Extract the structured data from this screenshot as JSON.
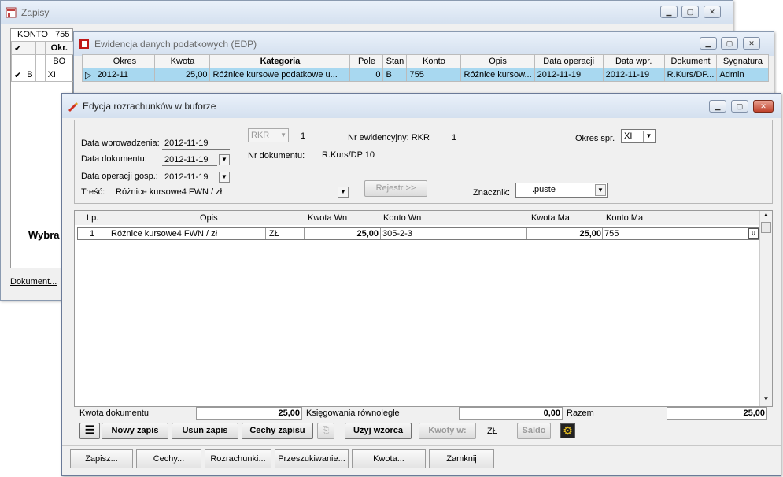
{
  "zapisy": {
    "title": "Zapisy",
    "konto_label": "KONTO",
    "konto_value": "755",
    "ok_header": "Okr.",
    "rows": [
      {
        "col1": "",
        "col2": "",
        "col3": "",
        "okr": "BO"
      },
      {
        "col1": "✔",
        "col2": "B",
        "col3": "",
        "okr": "XI"
      }
    ],
    "wybra": "Wybra",
    "dokument_btn": "Dokument..."
  },
  "edp": {
    "title": "Ewidencja danych podatkowych (EDP)",
    "columns": [
      "Okres",
      "Kwota",
      "Kategoria",
      "Pole",
      "Stan",
      "Konto",
      "Opis",
      "Data operacji",
      "Data wpr.",
      "Dokument",
      "Sygnatura"
    ],
    "row": {
      "okres": "2012-11",
      "kwota": "25,00",
      "kategoria": "Różnice kursowe podatkowe u...",
      "pole": "0",
      "stan": "B",
      "konto": "755",
      "opis": "Różnice kursow...",
      "data_operacji": "2012-11-19",
      "data_wpr": "2012-11-19",
      "dokument": "R.Kurs/DP...",
      "sygnatura": "Admin"
    }
  },
  "edycja": {
    "title": "Edycja rozrachunków w buforze",
    "data_wprowadzenia_label": "Data wprowadzenia:",
    "data_wprowadzenia": "2012-11-19",
    "data_dokumentu_label": "Data dokumentu:",
    "data_dokumentu": "2012-11-19",
    "data_operacji_label": "Data operacji gosp.:",
    "data_operacji": "2012-11-19",
    "tresc_label": "Treść:",
    "tresc": "Różnice kursowe4 FWN / zł",
    "rkr": "RKR",
    "rkr_num": "1",
    "nr_ewid_label": "Nr ewidencyjny:",
    "nr_ewid_value": "RKR",
    "nr_ewid_num": "1",
    "nr_dok_label": "Nr dokumentu:",
    "nr_dok": "R.Kurs/DP 10",
    "okres_spr_label": "Okres spr.",
    "okres_spr": "XI",
    "rejestr_btn": "Rejestr >>",
    "znacznik_label": "Znacznik:",
    "znacznik": ".puste",
    "grid_headers": {
      "lp": "Lp.",
      "opis": "Opis",
      "kwota_wn": "Kwota  Wn",
      "konto_wn": "Konto  Wn",
      "kwota_ma": "Kwota Ma",
      "konto_ma": "Konto Ma"
    },
    "grid_row": {
      "lp": "1",
      "opis": "Różnice kursowe4 FWN / zł",
      "waluta": "ZŁ",
      "kwota_wn": "25,00",
      "konto_wn": "305-2-3",
      "kwota_ma": "25,00",
      "konto_ma": "755"
    },
    "kwota_dok_label": "Kwota dokumentu",
    "kwota_dok": "25,00",
    "ksieg_rown_label": "Księgowania równoległe",
    "ksieg_rown": "0,00",
    "razem_label": "Razem",
    "razem": "25,00",
    "btn_nowy": "Nowy zapis",
    "btn_usun": "Usuń zapis",
    "btn_cechy_zapisu": "Cechy zapisu",
    "btn_uzyj": "Użyj wzorca",
    "btn_kwoty": "Kwoty w:",
    "waluta": "ZŁ",
    "btn_saldo": "Saldo",
    "bottom": {
      "zapisz": "Zapisz...",
      "cechy": "Cechy...",
      "rozrachunki": "Rozrachunki...",
      "przeszukiwanie": "Przeszukiwanie...",
      "kwota": "Kwota...",
      "zamknij": "Zamknij"
    }
  }
}
